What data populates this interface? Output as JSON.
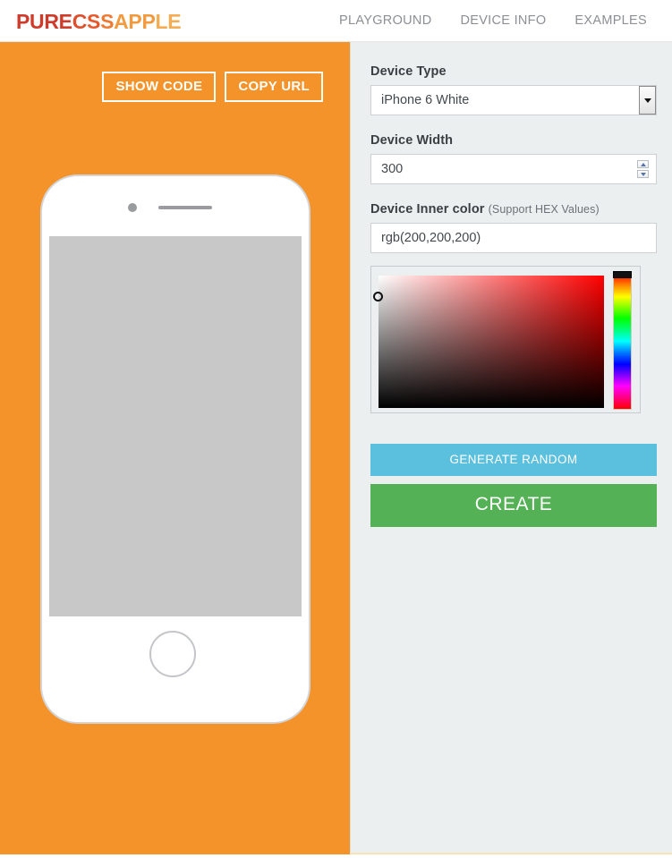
{
  "header": {
    "logo_parts": [
      {
        "text": "PURE",
        "color": "#cf3b2b"
      },
      {
        "text": "C",
        "color": "#de4f2d"
      },
      {
        "text": "S",
        "color": "#e7592d"
      },
      {
        "text": "S",
        "color": "#ef7a33"
      },
      {
        "text": "APP",
        "color": "#f29a3f"
      },
      {
        "text": "LE",
        "color": "#f5ad53"
      }
    ],
    "logo_text": "PURECSSAPPLE",
    "nav": [
      {
        "label": "PLAYGROUND"
      },
      {
        "label": "DEVICE INFO"
      },
      {
        "label": "EXAMPLES"
      }
    ]
  },
  "preview": {
    "show_code_label": "SHOW CODE",
    "copy_url_label": "COPY URL",
    "panel_color": "#f4932a",
    "device_name": "iPhone 6 White",
    "screen_color": "rgb(200,200,200)"
  },
  "form": {
    "device_type": {
      "label": "Device Type",
      "value": "iPhone 6 White",
      "options": [
        "iPhone 6 White"
      ]
    },
    "device_width": {
      "label": "Device Width",
      "value": "300"
    },
    "device_inner_color": {
      "label": "Device Inner color",
      "hint": "(Support HEX Values)",
      "value": "rgb(200,200,200)",
      "placeholder": "rgb(200,200,200)"
    },
    "colorpicker": {
      "hue": "#ff0000",
      "selected": "rgb(200,200,200)"
    },
    "generate_label": "GENERATE RANDOM",
    "create_label": "CREATE",
    "generate_color": "#5bc0de",
    "create_color": "#55b155"
  }
}
